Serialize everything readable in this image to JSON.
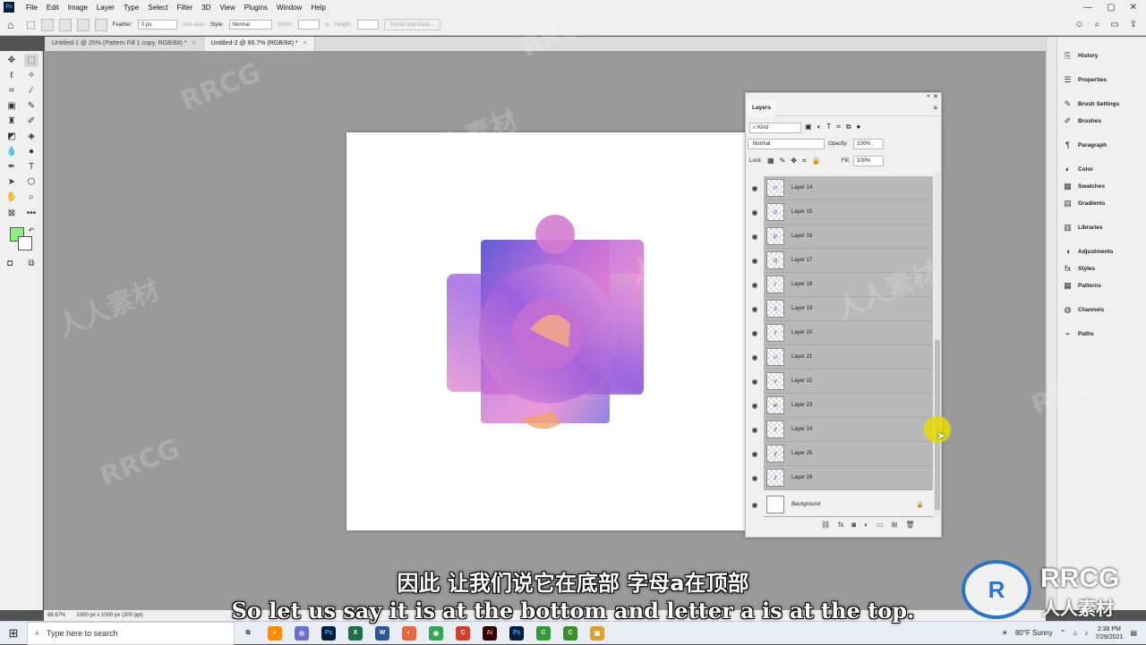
{
  "menu": {
    "logo": "Ps",
    "items": [
      "File",
      "Edit",
      "Image",
      "Layer",
      "Type",
      "Select",
      "Filter",
      "3D",
      "View",
      "Plugins",
      "Window",
      "Help"
    ]
  },
  "options": {
    "feather_label": "Feather:",
    "feather_value": "0 px",
    "antialias_label": "Anti-alias",
    "style_label": "Style:",
    "style_value": "Normal",
    "width_label": "Width:",
    "height_label": "Height:",
    "select_mask_label": "Select and Mask..."
  },
  "tabs": [
    {
      "label": "Untitled-1 @ 25% (Pattern Fill 1 copy, RGB/8#) *",
      "close": "×"
    },
    {
      "label": "Untitled-2 @ 66.7% (RGB/8#) *",
      "close": "×"
    }
  ],
  "colors": {
    "foreground": "#8ff081",
    "background": "#ffffff",
    "accent_selection": "#b9b9b9"
  },
  "layers_panel": {
    "title": "Layers",
    "filter_kind": "Kind",
    "blend_mode": "Normal",
    "opacity_label": "Opacity:",
    "opacity_value": "100%",
    "lock_label": "Lock:",
    "fill_label": "Fill:",
    "fill_value": "100%",
    "layers": [
      {
        "name": "Layer 14",
        "glyph": "n"
      },
      {
        "name": "Layer 15",
        "glyph": "o"
      },
      {
        "name": "Layer 16",
        "glyph": "p"
      },
      {
        "name": "Layer 17",
        "glyph": "q"
      },
      {
        "name": "Layer 18",
        "glyph": "r"
      },
      {
        "name": "Layer 19",
        "glyph": "s"
      },
      {
        "name": "Layer 20",
        "glyph": "t"
      },
      {
        "name": "Layer 21",
        "glyph": "u"
      },
      {
        "name": "Layer 22",
        "glyph": "v"
      },
      {
        "name": "Layer 23",
        "glyph": "w"
      },
      {
        "name": "Layer 24",
        "glyph": "x"
      },
      {
        "name": "Layer 25",
        "glyph": "y"
      },
      {
        "name": "Layer 26",
        "glyph": "z"
      }
    ],
    "background_layer": "Background"
  },
  "right_panels": [
    {
      "label": "History",
      "icon": "history-icon",
      "glyph": "⎘"
    },
    {
      "label": "Properties",
      "icon": "properties-icon",
      "glyph": "☰"
    },
    {
      "label": "Brush Settings",
      "icon": "brush-settings-icon",
      "glyph": "✎"
    },
    {
      "label": "Brushes",
      "icon": "brushes-icon",
      "glyph": "✐"
    },
    {
      "label": "Paragraph",
      "icon": "paragraph-icon",
      "glyph": "¶"
    },
    {
      "label": "Color",
      "icon": "color-icon",
      "glyph": "◐"
    },
    {
      "label": "Swatches",
      "icon": "swatches-icon",
      "glyph": "▦"
    },
    {
      "label": "Gradients",
      "icon": "gradients-icon",
      "glyph": "▤"
    },
    {
      "label": "Libraries",
      "icon": "libraries-icon",
      "glyph": "▥"
    },
    {
      "label": "Adjustments",
      "icon": "adjustments-icon",
      "glyph": "◑"
    },
    {
      "label": "Styles",
      "icon": "styles-icon",
      "glyph": "fx"
    },
    {
      "label": "Patterns",
      "icon": "patterns-icon",
      "glyph": "▦"
    },
    {
      "label": "Channels",
      "icon": "channels-icon",
      "glyph": "◍"
    },
    {
      "label": "Paths",
      "icon": "paths-icon",
      "glyph": "⌁"
    }
  ],
  "status": {
    "zoom": "66.67%",
    "doc_size": "1000 px x 1000 px (300 ppi)"
  },
  "taskbar": {
    "search_placeholder": "Type here to search",
    "weather": "80°F Sunny",
    "time": "2:38 PM",
    "date": "7/29/2021"
  },
  "subtitles": {
    "cn": "因此 让我们说它在底部 字母a在顶部",
    "en": "So let us say it is at the bottom and letter a is at the top."
  },
  "watermark": {
    "text_en": "RRCG",
    "text_cn": "人人素材",
    "logo_text": "RRCG",
    "logo_sub": "人人素材"
  }
}
